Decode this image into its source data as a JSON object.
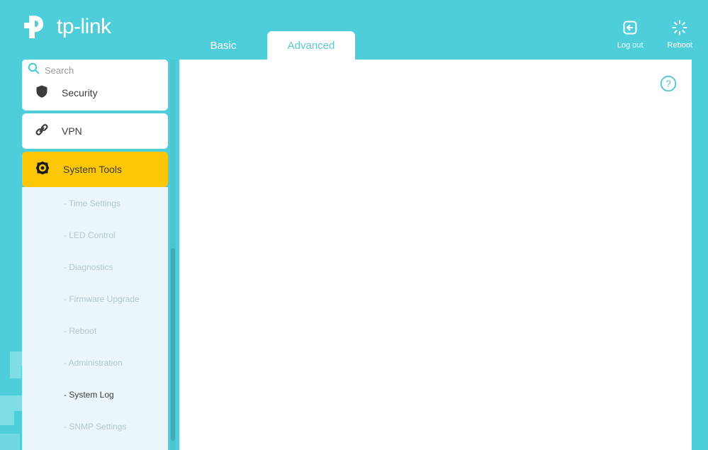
{
  "brand": {
    "name": "tp-link",
    "logo_icon": "tp-link-logo-icon"
  },
  "theme": {
    "teal": "#4ecdda",
    "teal_light": "#7fdde6",
    "accent_yellow": "#fbc707",
    "submenu_bg": "#eaf6f9",
    "content_bg": "#ffffff",
    "tab_active_text": "#5bc8d4"
  },
  "header": {
    "tabs": [
      {
        "label": "Basic",
        "active": false
      },
      {
        "label": "Advanced",
        "active": true
      }
    ],
    "actions": [
      {
        "label": "Log out",
        "icon": "logout-icon"
      },
      {
        "label": "Reboot",
        "icon": "reboot-icon"
      }
    ]
  },
  "sidebar": {
    "search": {
      "placeholder": "Search",
      "value": "",
      "icon": "search-icon"
    },
    "items": [
      {
        "label": "Security",
        "icon": "shield-icon",
        "active": false
      },
      {
        "label": "VPN",
        "icon": "link-chain-icon",
        "active": false
      },
      {
        "label": "System Tools",
        "icon": "gear-icon",
        "active": true
      }
    ],
    "submenu": [
      {
        "label": "- Time Settings",
        "active": false
      },
      {
        "label": "- LED Control",
        "active": false
      },
      {
        "label": "- Diagnostics",
        "active": false
      },
      {
        "label": "- Firmware Upgrade",
        "active": false
      },
      {
        "label": "- Reboot",
        "active": false
      },
      {
        "label": "- Administration",
        "active": false
      },
      {
        "label": "- System Log",
        "active": true
      },
      {
        "label": "- SNMP Settings",
        "active": false
      }
    ]
  },
  "content": {
    "help_icon": "help-circle-icon"
  }
}
